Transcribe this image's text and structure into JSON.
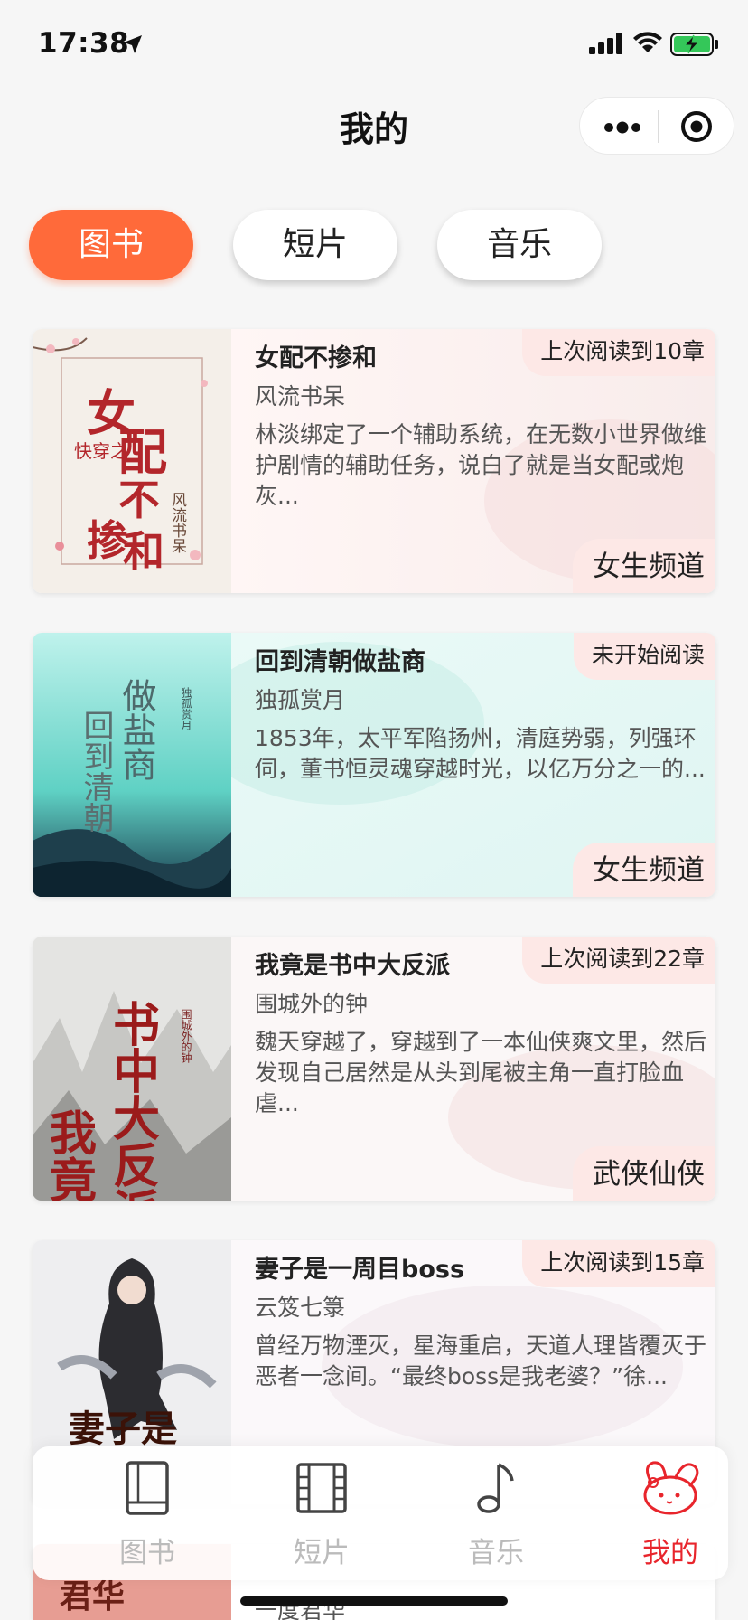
{
  "status_bar": {
    "time": "17:38"
  },
  "nav": {
    "title": "我的"
  },
  "categories": [
    {
      "label": "图书",
      "active": true
    },
    {
      "label": "短片",
      "active": false
    },
    {
      "label": "音乐",
      "active": false
    }
  ],
  "books": [
    {
      "title": "女配不掺和",
      "author": "风流书呆",
      "description": "林淡绑定了一个辅助系统，在无数小世界做维护剧情的辅助任务，说白了就是当女配或炮灰...",
      "progress": "上次阅读到10章",
      "channel": "女生频道",
      "cover": {
        "title": "女配不掺和",
        "tag": "快穿之",
        "author": "风流书呆"
      }
    },
    {
      "title": "回到清朝做盐商",
      "author": "独孤赏月",
      "description": "1853年，太平军陷扬州，清庭势弱，列强环伺，董书恒灵魂穿越时光，以亿万分之一的...",
      "progress": "未开始阅读",
      "channel": "女生频道",
      "cover": {
        "title": "回到清朝做盐商",
        "tag": "",
        "author": "独孤赏月"
      }
    },
    {
      "title": "我竟是书中大反派",
      "author": "围城外的钟",
      "description": "魏天穿越了，穿越到了一本仙侠爽文里，然后发现自己居然是从头到尾被主角一直打脸血虐...",
      "progress": "上次阅读到22章",
      "channel": "武侠仙侠",
      "cover": {
        "title": "我竟是书中大反派",
        "tag": "",
        "author": "围城外的钟"
      }
    },
    {
      "title": "妻子是一周目boss",
      "author": "云笈七箓",
      "description": "曾经万物湮灭，星海重启，天道人理皆覆灭于恶者一念间。“最终boss是我老婆？”徐...",
      "progress": "上次阅读到15章",
      "channel": "",
      "cover": {
        "title": "妻子是",
        "tag": "",
        "author": ""
      }
    },
    {
      "title": "",
      "author": "一度君华",
      "description": "",
      "progress": "",
      "channel": "",
      "cover": {
        "title": "",
        "tag": "",
        "author": ""
      }
    }
  ],
  "tab_bar": {
    "items": [
      {
        "label": "图书",
        "icon": "book-icon",
        "active": false
      },
      {
        "label": "短片",
        "icon": "film-icon",
        "active": false
      },
      {
        "label": "音乐",
        "icon": "music-note-icon",
        "active": false
      },
      {
        "label": "我的",
        "icon": "rabbit-mascot-icon",
        "active": true
      }
    ]
  },
  "colors": {
    "accent": "#ff6a3a",
    "active_tab": "#e8252c",
    "badge_bg": "#fde8e6",
    "inactive_tab": "#bbbbbb"
  }
}
